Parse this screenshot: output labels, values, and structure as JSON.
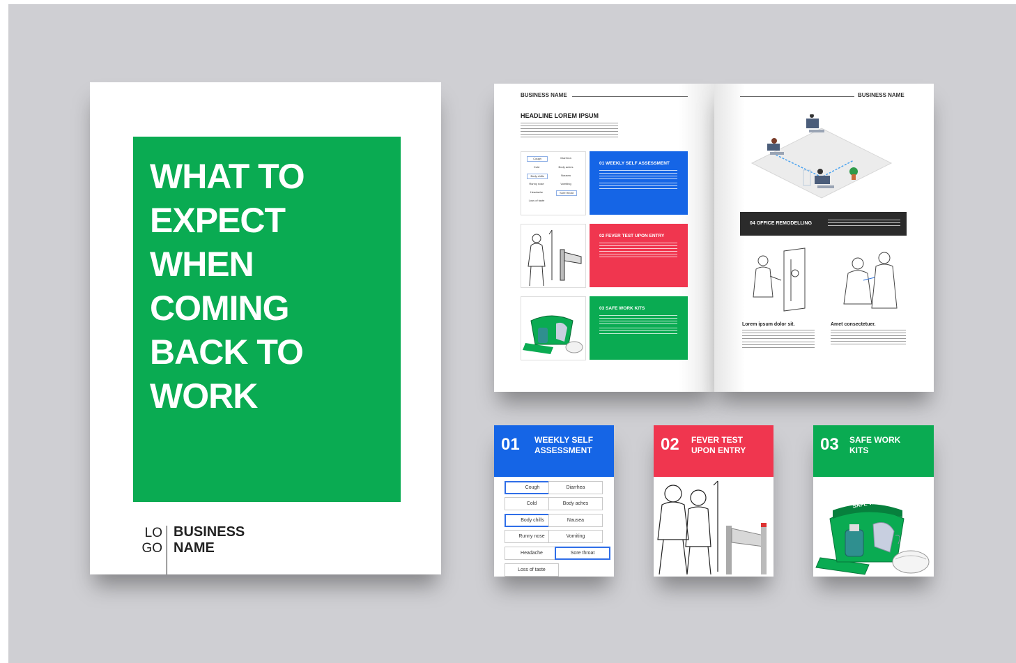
{
  "cover": {
    "title_lines": [
      "WHAT TO",
      "EXPECT",
      "WHEN",
      "COMING",
      "BACK TO",
      "WORK"
    ],
    "logo_line1": "LO",
    "logo_line2": "GO",
    "business_line1": "BUSINESS",
    "business_line2": "NAME"
  },
  "spread": {
    "left": {
      "header": "BUSINESS NAME",
      "headline": "HEADLINE LOREM IPSUM",
      "blocks": [
        {
          "title": "01 WEEKLY SELF ASSESSMENT",
          "color": "#1565e6"
        },
        {
          "title": "02 FEVER TEST UPON ENTRY",
          "color": "#f0364f"
        },
        {
          "title": "03 SAFE WORK KITS",
          "color": "#0aab52"
        }
      ],
      "mini_symptoms": [
        "Cough",
        "Diarrhea",
        "Cold",
        "Body aches",
        "Body chills",
        "Nausea",
        "Runny nose",
        "Vomiting",
        "Headache",
        "Sore throat",
        "Loss of taste"
      ]
    },
    "right": {
      "header": "BUSINESS NAME",
      "banner_title": "04 OFFICE REMODELLING",
      "col1_title": "Lorem ipsum dolor sit.",
      "col2_title": "Amet consectetuer."
    }
  },
  "cards": [
    {
      "num": "01",
      "label_line1": "WEEKLY SELF",
      "label_line2": "ASSESSMENT",
      "color": "#1565e6"
    },
    {
      "num": "02",
      "label_line1": "FEVER TEST",
      "label_line2": "UPON ENTRY",
      "color": "#f0364f"
    },
    {
      "num": "03",
      "label_line1": "SAFE WORK",
      "label_line2": "KITS",
      "color": "#0aab52"
    }
  ],
  "symptoms": {
    "items": [
      "Cough",
      "Diarrhea",
      "Cold",
      "Body aches",
      "Body chills",
      "Nausea",
      "Runny nose",
      "Vomiting",
      "Headache",
      "Sore throat",
      "Loss of taste"
    ],
    "selected": [
      "Cough",
      "Body chills",
      "Sore throat"
    ]
  },
  "kit_label": "SAFE WORK KIT",
  "colors": {
    "background": "#cfcfd3",
    "green": "#0aab52",
    "blue": "#1565e6",
    "red": "#f0364f",
    "dark": "#222222"
  }
}
